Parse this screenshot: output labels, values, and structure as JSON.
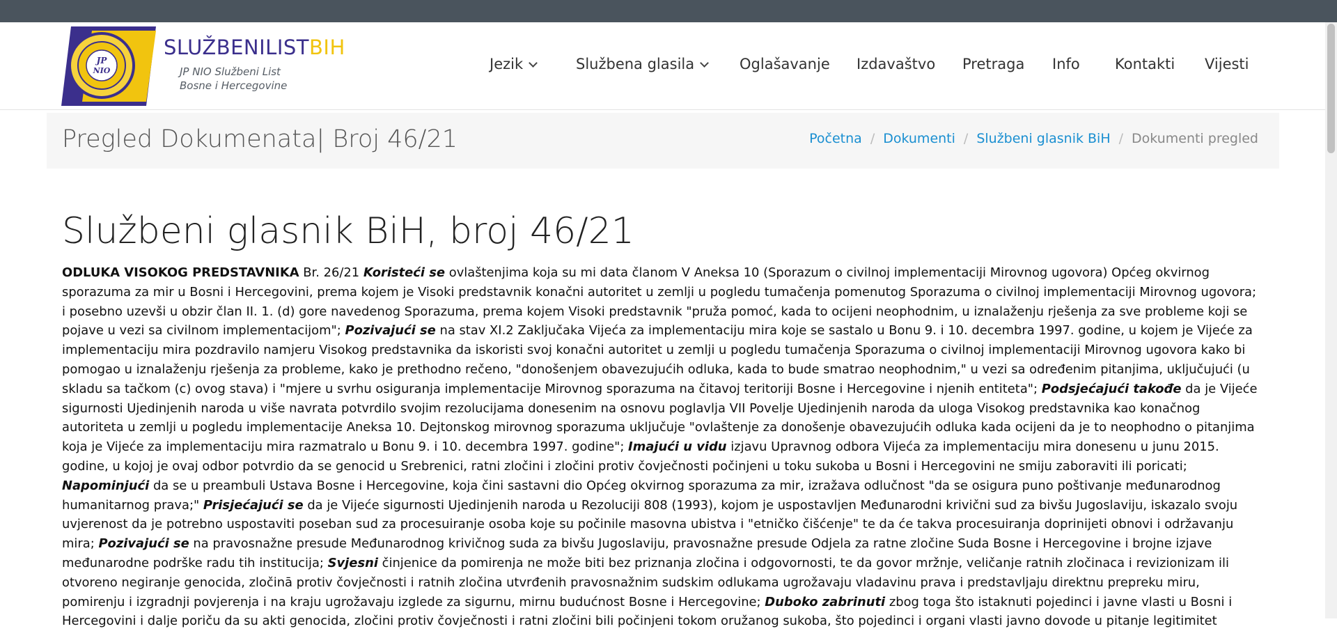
{
  "brand": {
    "part1": "SLUŽBENI",
    "part2": "LIST",
    "part3": "BIH",
    "tagline1": "JP NIO Službeni List",
    "tagline2": "Bosne i Hercegovine",
    "emblem_center": "JP NIO",
    "emblem_ring": "SLUŽBENI LIST BiH • SARAJEVO •"
  },
  "nav": [
    {
      "label": "Jezik",
      "dropdown": true
    },
    {
      "label": "Službena glasila",
      "dropdown": true
    },
    {
      "label": "Oglašavanje",
      "dropdown": false
    },
    {
      "label": "Izdavaštvo",
      "dropdown": false
    },
    {
      "label": "Pretraga",
      "dropdown": false
    },
    {
      "label": "Info",
      "dropdown": false
    },
    {
      "label": "Kontakti",
      "dropdown": false
    },
    {
      "label": "Vijesti",
      "dropdown": false
    }
  ],
  "page_title": "Pregled Dokumenata| Broj 46/21",
  "breadcrumb": [
    "Početna",
    "Dokumenti",
    "Službeni glasnik BiH",
    "Dokumenti pregled"
  ],
  "doc": {
    "heading": "Službeni glasnik BiH, broj 46/21",
    "segments": [
      {
        "t": "ODLUKA VISOKOG PREDSTAVNIKA",
        "s": "h"
      },
      {
        "t": " Br. 26/21 ",
        "s": ""
      },
      {
        "t": "Koristeći se",
        "s": "i"
      },
      {
        "t": " ovlaštenjima koja su mi data članom V Aneksa 10 (Sporazum o civilnoj implementaciji Mirovnog ugovora) Općeg okvirnog sporazuma za mir u Bosni i Hercegovini, prema kojem je Visoki predstavnik konačni autoritet u zemlji u pogledu tumačenja pomenutog Sporazuma o civilnoj implementaciji Mirovnog ugovora; i posebno uzevši u obzir član II. 1. (d) gore navedenog Sporazuma, prema kojem Visoki predstavnik \"pruža pomoć, kada to ocijeni neophodnim, u iznalaženju rješenja za sve probleme koji se pojave u vezi sa civilnom implementacijom\"; ",
        "s": ""
      },
      {
        "t": "Pozivajući se",
        "s": "i"
      },
      {
        "t": " na stav XI.2 Zaključaka Vijeća za implementaciju mira koje se sastalo u Bonu 9. i 10. decembra 1997. godine, u kojem je Vijeće za implementaciju mira pozdravilo namjeru Visokog predstavnika da iskoristi svoj konačni autoritet u zemlji u pogledu tumačenja Sporazuma o civilnoj implementaciji Mirovnog ugovora kako bi pomogao u iznalaženju rješenja za probleme, kako je prethodno rečeno, \"donošenjem obavezujućih odluka, kada to bude smatrao neophodnim,\" u vezi sa određenim pitanjima, uključujući (u skladu sa tačkom (c) ovog stava) i \"mjere u svrhu osiguranja implementacije Mirovnog sporazuma na čitavoj teritoriji Bosne i Hercegovine i njenih entiteta\"; ",
        "s": ""
      },
      {
        "t": "Podsjećajući takođe",
        "s": "i"
      },
      {
        "t": " da je Vijeće sigurnosti Ujedinjenih naroda u više navrata potvrdilo svojim rezolucijama donesenim na osnovu poglavlja VII Povelje Ujedinjenih naroda da uloga Visokog predstavnika kao konačnog autoriteta u zemlji u pogledu implementacije Aneksa 10. Dejtonskog mirovnog sporazuma uključuje \"ovlaštenje za donošenje obavezujućih odluka kada ocijeni da je to neophodno o pitanjima koja je Vijeće za implementaciju mira razmatralo u Bonu 9. i 10. decembra 1997. godine\"; ",
        "s": ""
      },
      {
        "t": "Imajući u vidu",
        "s": "i"
      },
      {
        "t": " izjavu Upravnog odbora Vijeća za implementaciju mira donesenu u junu 2015. godine, u kojoj je ovaj odbor potvrdio da se genocid u Srebrenici, ratni zločini i zločini protiv čovječnosti počinjeni u toku sukoba u Bosni i Hercegovini ne smiju zaboraviti ili poricati; ",
        "s": ""
      },
      {
        "t": "Napominjući",
        "s": "i"
      },
      {
        "t": " da se u preambuli Ustava Bosne i Hercegovine, koja čini sastavni dio Općeg okvirnog sporazuma za mir, izražava odlučnost \"da se osigura puno poštivanje međunarodnog humanitarnog prava;\" ",
        "s": ""
      },
      {
        "t": "Prisjećajući se",
        "s": "i"
      },
      {
        "t": " da je Vijeće sigurnosti Ujedinjenih naroda u Rezoluciji 808 (1993), kojom je uspostavljen Međunarodni krivični sud za bivšu Jugoslaviju, iskazalo svoju uvjerenost da je potrebno uspostaviti poseban sud za procesuiranje osoba koje su počinile masovna ubistva i \"etničko čišćenje\" te da će takva procesuiranja doprinijeti obnovi i održavanju mira; ",
        "s": ""
      },
      {
        "t": "Pozivajući se",
        "s": "i"
      },
      {
        "t": " na pravosnažne presude Međunarodnog krivičnog suda za bivšu Jugoslaviju, pravosnažne presude Odjela za ratne zločine Suda Bosne i Hercegovine i brojne izjave međunarodne podrške radu tih institucija; ",
        "s": ""
      },
      {
        "t": "Svjesni",
        "s": "i"
      },
      {
        "t": " činjenice da pomirenja ne može biti bez priznanja zločina i odgovornosti, te da govor mržnje, veličanje ratnih zločinaca i revizionizam ili otvoreno negiranje genocida, zločinā protiv čovječnosti i ratnih zločina utvrđenih pravosnažnim sudskim odlukama ugrožavaju vladavinu prava i predstavljaju direktnu prepreku miru, pomirenju i izgradnji povjerenja i na kraju ugrožavaju izglede za sigurnu, mirnu budućnost Bosne i Hercegovine; ",
        "s": ""
      },
      {
        "t": "Duboko zabrinuti",
        "s": "i"
      },
      {
        "t": " zbog toga što istaknuti pojedinci i javne vlasti u Bosni i Hercegovini i dalje poriču da su akti genocida, zločini protiv čovječnosti i ratni zločini bili počinjeni tokom oružanog sukoba, što pojedinci i organi vlasti javno dovode u pitanje legitimitet",
        "s": ""
      }
    ]
  }
}
